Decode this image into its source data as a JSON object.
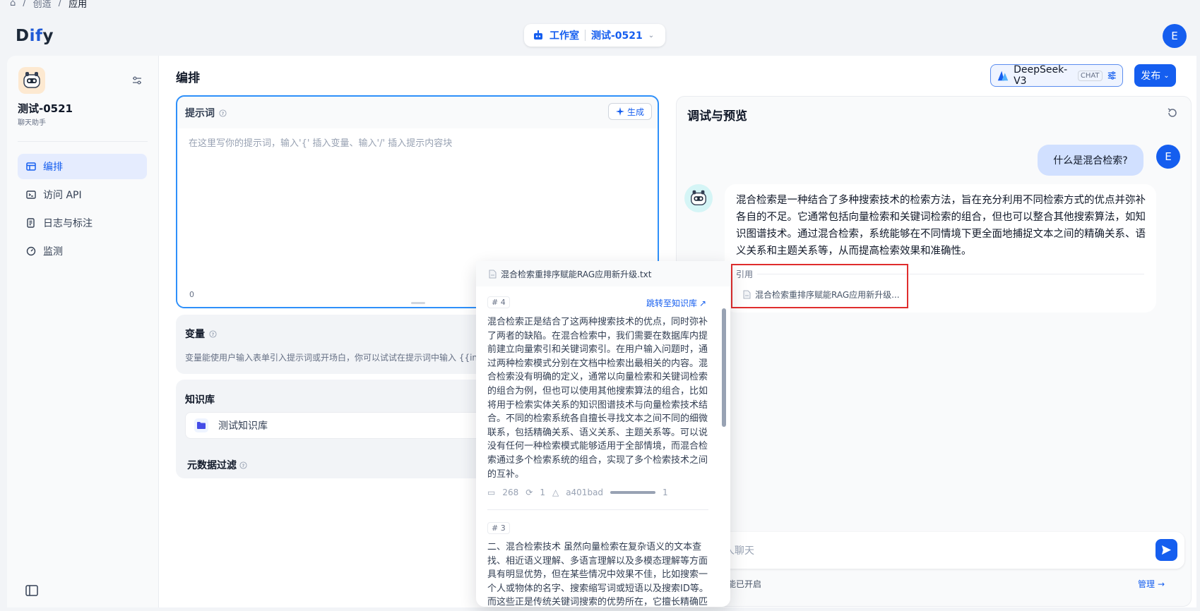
{
  "breadcrumb": {
    "home": "⌂",
    "items": [
      "创造",
      "应用"
    ]
  },
  "header": {
    "logo_prefix": "D",
    "logo_accent": "if",
    "logo_suffix": "y",
    "studio_label": "工作室",
    "app_switch": "测试-0521",
    "user_initial": "E"
  },
  "sidebar": {
    "app_name": "测试-0521",
    "app_type": "聊天助手",
    "items": [
      {
        "label": "编排",
        "icon": "layout-icon",
        "active": true
      },
      {
        "label": "访问 API",
        "icon": "terminal-icon"
      },
      {
        "label": "日志与标注",
        "icon": "file-list-icon"
      },
      {
        "label": "监测",
        "icon": "gauge-icon"
      }
    ]
  },
  "main": {
    "title": "编排",
    "model_name": "DeepSeek-V3",
    "model_tag": "CHAT",
    "publish_label": "发布",
    "prompt": {
      "title": "提示词",
      "generate_label": "生成",
      "placeholder": "在这里写你的提示词，输入'{' 插入变量、输入'/' 插入提示内容块",
      "char_count": "0"
    },
    "variables": {
      "title": "变量",
      "description": "变量能使用户输入表单引入提示词或开场白，你可以试试在提示词中输入 {{inp"
    },
    "knowledge": {
      "title": "知识库",
      "item": "测试知识库"
    },
    "metadata_filter": {
      "title": "元数据过滤"
    }
  },
  "debug": {
    "title": "调试与预览",
    "user_question": "什么是混合检索?",
    "answer": "混合检索是一种结合了多种搜索技术的检索方法，旨在充分利用不同检索方式的优点并弥补各自的不足。它通常包括向量检索和关键词检索的组合，但也可以整合其他搜索算法，如知识图谱技术。通过混合检索，系统能够在不同情境下更全面地捕捉文本之间的精确关系、语义关系和主题关系等，从而提高检索效果和准确性。",
    "citation_label": "引用",
    "citation_file": "混合检索重排序赋能RAG应用新升级...",
    "input_placeholder": "人聊天",
    "feature_text": "能已开启",
    "manage_label": "管理"
  },
  "popup": {
    "file_name": "混合检索重排序赋能RAG应用新升级.txt",
    "segment_1": {
      "number": "# 4",
      "jump_label": "跳转至知识库",
      "text": "混合检索正是结合了这两种搜索技术的优点，同时弥补了两者的缺陷。在混合检索中，我们需要在数据库内提前建立向量索引和关键词索引。在用户输入问题时，通过两种检索模式分别在文档中检索出最相关的内容。混合检索没有明确的定义，通常以向量检索和关键词检索的组合为例，但也可以使用其他搜索算法的组合，比如将用于检索实体关系的知识图谱技术与向量检索技术结合。不同的检索系统各自擅长寻找文本之间不同的细微联系，包括精确关系、语义关系、主题关系等。可以说没有任何一种检索模式能够适用于全部情境，而混合检索通过多个检索系统的组合，实现了多个检索技术之间的互补。",
      "words": "268",
      "hits": "1",
      "hash": "a401bad",
      "score": "1",
      "score_fill": 1.0
    },
    "segment_2": {
      "number": "# 3",
      "text": "二、混合检索技术 虽然向量检索在复杂语义的文本查找、相近语义理解、多语言理解以及多模态理解等方面具有明显优势，但在某些情况中效果不佳，比如搜索一个人或物体的名字、搜索缩写词或短语以及搜索ID等。而这些正是传统关键词搜索的优势所在，它擅长精确匹"
    }
  },
  "colors": {
    "accent": "#155eef",
    "highlight_border": "#e02d2d"
  }
}
